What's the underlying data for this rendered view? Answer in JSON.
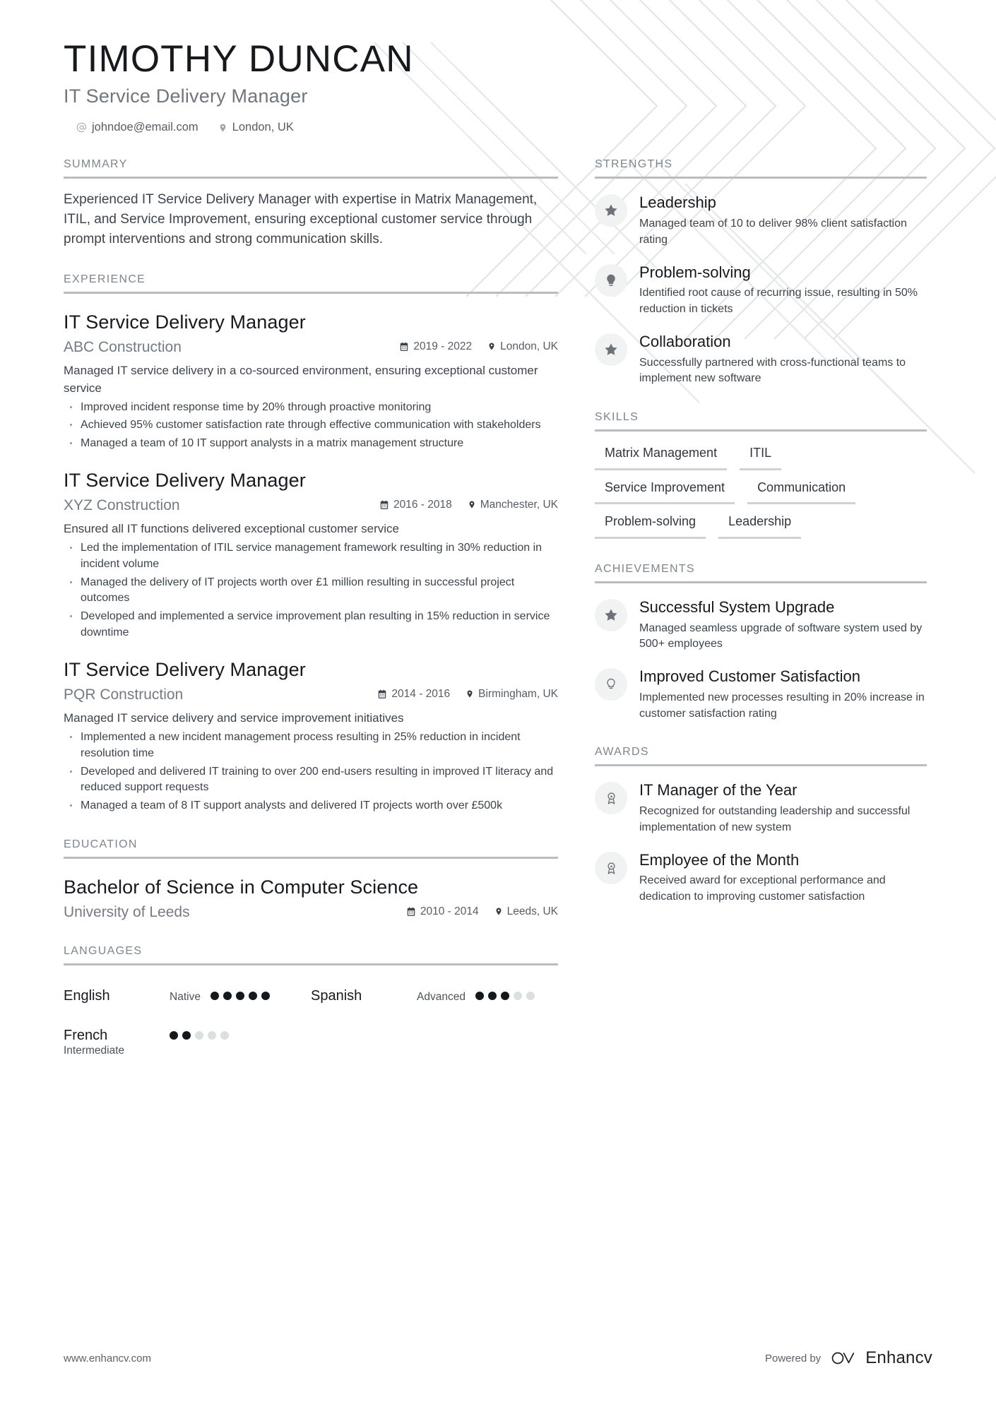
{
  "header": {
    "name": "TIMOTHY DUNCAN",
    "job_title": "IT Service Delivery Manager",
    "email": "johndoe@email.com",
    "location": "London, UK",
    "email_icon": "at-sign-icon",
    "location_icon": "map-pin-icon"
  },
  "sections": {
    "summary": "SUMMARY",
    "experience": "EXPERIENCE",
    "education": "EDUCATION",
    "languages": "LANGUAGES",
    "strengths": "STRENGTHS",
    "skills": "SKILLS",
    "achievements": "ACHIEVEMENTS",
    "awards": "AWARDS"
  },
  "summary": {
    "text": "Experienced IT Service Delivery Manager with expertise in Matrix Management, ITIL, and Service Improvement, ensuring exceptional customer service through prompt interventions and strong communication skills."
  },
  "experience": [
    {
      "title": "IT Service Delivery Manager",
      "company": "ABC Construction",
      "dates": "2019 - 2022",
      "location": "London, UK",
      "description": "Managed IT service delivery in a co-sourced environment, ensuring exceptional customer service",
      "bullets": [
        "Improved incident response time by 20% through proactive monitoring",
        "Achieved 95% customer satisfaction rate through effective communication with stakeholders",
        "Managed a team of 10 IT support analysts in a matrix management structure"
      ]
    },
    {
      "title": "IT Service Delivery Manager",
      "company": "XYZ Construction",
      "dates": "2016 - 2018",
      "location": "Manchester, UK",
      "description": "Ensured all IT functions delivered exceptional customer service",
      "bullets": [
        "Led the implementation of ITIL service management framework resulting in 30% reduction in incident volume",
        "Managed the delivery of IT projects worth over £1 million resulting in successful project outcomes",
        "Developed and implemented a service improvement plan resulting in 15% reduction in service downtime"
      ]
    },
    {
      "title": "IT Service Delivery Manager",
      "company": "PQR Construction",
      "dates": "2014 - 2016",
      "location": "Birmingham, UK",
      "description": "Managed IT service delivery and service improvement initiatives",
      "bullets": [
        "Implemented a new incident management process resulting in 25% reduction in incident resolution time",
        "Developed and delivered IT training to over 200 end-users resulting in improved IT literacy and reduced support requests",
        "Managed a team of 8 IT support analysts and delivered IT projects worth over £500k"
      ]
    }
  ],
  "education": [
    {
      "degree": "Bachelor of Science in Computer Science",
      "institution": "University of Leeds",
      "dates": "2010 - 2014",
      "location": "Leeds, UK"
    }
  ],
  "languages": [
    {
      "name": "English",
      "level": "Native",
      "level_inline": true,
      "filled": 5,
      "total": 5
    },
    {
      "name": "Spanish",
      "level": "Advanced",
      "level_inline": true,
      "filled": 3,
      "total": 5
    },
    {
      "name": "French",
      "level": "Intermediate",
      "level_inline": false,
      "filled": 2,
      "total": 5
    }
  ],
  "strengths": [
    {
      "icon": "star-icon",
      "title": "Leadership",
      "description": "Managed team of 10 to deliver 98% client satisfaction rating"
    },
    {
      "icon": "lightbulb-icon",
      "title": "Problem-solving",
      "description": "Identified root cause of recurring issue, resulting in 50% reduction in tickets"
    },
    {
      "icon": "star-icon",
      "title": "Collaboration",
      "description": "Successfully partnered with cross-functional teams to implement new software"
    }
  ],
  "skills": [
    "Matrix Management",
    "ITIL",
    "Service Improvement",
    "Communication",
    "Problem-solving",
    "Leadership"
  ],
  "achievements": [
    {
      "icon": "star-icon",
      "title": "Successful System Upgrade",
      "description": "Managed seamless upgrade of software system used by 500+ employees"
    },
    {
      "icon": "lightbulb-icon",
      "title": "Improved Customer Satisfaction",
      "description": "Implemented new processes resulting in 20% increase in customer satisfaction rating"
    }
  ],
  "awards": [
    {
      "icon": "award-medal-icon",
      "title": "IT Manager of the Year",
      "description": "Recognized for outstanding leadership and successful implementation of new system"
    },
    {
      "icon": "award-medal-icon",
      "title": "Employee of the Month",
      "description": "Received award for exceptional performance and dedication to improving customer satisfaction"
    }
  ],
  "footer": {
    "url": "www.enhancv.com",
    "powered_by": "Powered by",
    "brand": "Enhancv",
    "brand_mark": "enhancv-logo-icon"
  },
  "colors": {
    "text_dark": "#16191d",
    "text_body": "#3c444c",
    "muted": "#747b82",
    "rule": "#b9bdc1",
    "badge_bg": "#f1f2f2",
    "icon_gray": "#6d7479"
  }
}
